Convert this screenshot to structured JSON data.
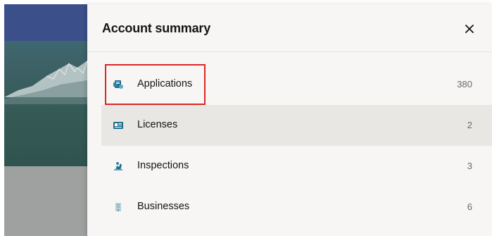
{
  "drawer": {
    "title": "Account summary",
    "close_icon": "close-icon"
  },
  "items": [
    {
      "label": "Applications",
      "count": "380",
      "icon": "applications-icon"
    },
    {
      "label": "Licenses",
      "count": "2",
      "icon": "license-icon"
    },
    {
      "label": "Inspections",
      "count": "3",
      "icon": "inspection-icon"
    },
    {
      "label": "Businesses",
      "count": "6",
      "icon": "business-icon"
    }
  ],
  "colors": {
    "drawer_bg": "#f8f6f4",
    "selected_bg": "#e9e7e4",
    "highlight": "#d92626",
    "icon_accent": "#1e6e8c"
  }
}
